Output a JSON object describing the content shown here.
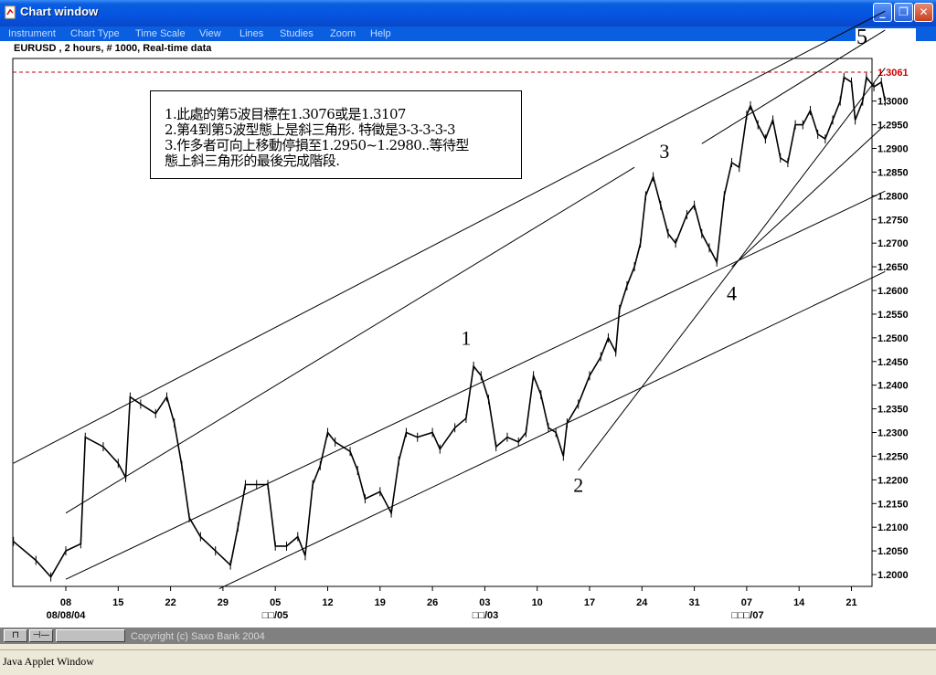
{
  "window": {
    "title": "Chart window",
    "controls": {
      "minimize": "_",
      "restore": "❐",
      "close": "✕"
    }
  },
  "menu": [
    "Instrument",
    "Chart Type",
    "Time Scale",
    "View",
    "Lines",
    "Studies",
    "Zoom",
    "Help"
  ],
  "chart_header": "EURUSD , 2 hours, # 1000, Real-time data",
  "annotation": {
    "lines": [
      "1.此處的第5波目標在1.3076或是1.3107",
      "2.第4到第5波型態上是斜三角形.   特徵是3-3-3-3-3",
      "3.作多者可向上移動停損至1.2950~1.2980..等待型",
      "態上斜三角形的最後完成階段."
    ]
  },
  "status": {
    "copyright": "Copyright (c) Saxo Bank 2004",
    "button1": "⊓",
    "button2": "⊣—"
  },
  "applet_label": "Java Applet Window",
  "colors": {
    "price_line": "#000000",
    "reference_line": "#cc0000",
    "current_price_label": "#cc0000"
  },
  "chart_data": {
    "type": "line",
    "title": "EURUSD , 2 hours, # 1000, Real-time data",
    "ylim": [
      1.1975,
      1.309
    ],
    "y_ticks": [
      "1.2000",
      "1.2050",
      "1.2100",
      "1.2150",
      "1.2200",
      "1.2250",
      "1.2300",
      "1.2350",
      "1.2400",
      "1.2450",
      "1.2500",
      "1.2550",
      "1.2600",
      "1.2650",
      "1.2700",
      "1.2750",
      "1.2800",
      "1.2850",
      "1.2900",
      "1.2950",
      "1.3000"
    ],
    "current_price": "1.3061",
    "x_tick_labels": [
      "08",
      "15",
      "22",
      "29",
      "05",
      "12",
      "19",
      "26",
      "03",
      "10",
      "17",
      "24",
      "31",
      "07",
      "14",
      "21"
    ],
    "x_month_labels": [
      "08/08/04",
      "□□/05",
      "□□/03",
      "□□□/07"
    ],
    "series": [
      {
        "points": [
          {
            "x": 0,
            "y": 1.207
          },
          {
            "x": 3,
            "y": 1.203
          },
          {
            "x": 5,
            "y": 1.1995
          },
          {
            "x": 7,
            "y": 1.205
          },
          {
            "x": 9,
            "y": 1.2065
          },
          {
            "x": 9.6,
            "y": 1.229
          },
          {
            "x": 12,
            "y": 1.227
          },
          {
            "x": 14,
            "y": 1.2235
          },
          {
            "x": 15,
            "y": 1.2205
          },
          {
            "x": 15.6,
            "y": 1.2375
          },
          {
            "x": 17,
            "y": 1.236
          },
          {
            "x": 19,
            "y": 1.234
          },
          {
            "x": 20.5,
            "y": 1.2375
          },
          {
            "x": 21.5,
            "y": 1.232
          },
          {
            "x": 22.5,
            "y": 1.223
          },
          {
            "x": 23.5,
            "y": 1.212
          },
          {
            "x": 25,
            "y": 1.208
          },
          {
            "x": 27,
            "y": 1.205
          },
          {
            "x": 29,
            "y": 1.202
          },
          {
            "x": 30,
            "y": 1.21
          },
          {
            "x": 31,
            "y": 1.219
          },
          {
            "x": 32.5,
            "y": 1.219
          },
          {
            "x": 34,
            "y": 1.219
          },
          {
            "x": 35,
            "y": 1.206
          },
          {
            "x": 36.5,
            "y": 1.206
          },
          {
            "x": 38,
            "y": 1.208
          },
          {
            "x": 39,
            "y": 1.204
          },
          {
            "x": 40,
            "y": 1.219
          },
          {
            "x": 41,
            "y": 1.223
          },
          {
            "x": 42,
            "y": 1.23
          },
          {
            "x": 43,
            "y": 1.228
          },
          {
            "x": 45,
            "y": 1.226
          },
          {
            "x": 46,
            "y": 1.222
          },
          {
            "x": 47,
            "y": 1.216
          },
          {
            "x": 49,
            "y": 1.2175
          },
          {
            "x": 50.5,
            "y": 1.213
          },
          {
            "x": 51.5,
            "y": 1.224
          },
          {
            "x": 52.5,
            "y": 1.23
          },
          {
            "x": 54,
            "y": 1.229
          },
          {
            "x": 56,
            "y": 1.23
          },
          {
            "x": 57,
            "y": 1.2265
          },
          {
            "x": 59,
            "y": 1.231
          },
          {
            "x": 60.5,
            "y": 1.233
          },
          {
            "x": 61.5,
            "y": 1.244
          },
          {
            "x": 62.5,
            "y": 1.242
          },
          {
            "x": 63.5,
            "y": 1.237
          },
          {
            "x": 64.5,
            "y": 1.227
          },
          {
            "x": 66,
            "y": 1.229
          },
          {
            "x": 67.5,
            "y": 1.228
          },
          {
            "x": 68.5,
            "y": 1.23
          },
          {
            "x": 69.5,
            "y": 1.242
          },
          {
            "x": 70.5,
            "y": 1.238
          },
          {
            "x": 71.5,
            "y": 1.231
          },
          {
            "x": 72.5,
            "y": 1.23
          },
          {
            "x": 73.5,
            "y": 1.225
          },
          {
            "x": 74,
            "y": 1.232
          },
          {
            "x": 75.5,
            "y": 1.236
          },
          {
            "x": 77,
            "y": 1.242
          },
          {
            "x": 78.5,
            "y": 1.246
          },
          {
            "x": 79.5,
            "y": 1.25
          },
          {
            "x": 80.5,
            "y": 1.247
          },
          {
            "x": 81,
            "y": 1.256
          },
          {
            "x": 82,
            "y": 1.261
          },
          {
            "x": 83,
            "y": 1.265
          },
          {
            "x": 83.8,
            "y": 1.27
          },
          {
            "x": 84.5,
            "y": 1.28
          },
          {
            "x": 85.5,
            "y": 1.284
          },
          {
            "x": 86.5,
            "y": 1.278
          },
          {
            "x": 87.5,
            "y": 1.272
          },
          {
            "x": 88.5,
            "y": 1.27
          },
          {
            "x": 90,
            "y": 1.276
          },
          {
            "x": 91,
            "y": 1.278
          },
          {
            "x": 92,
            "y": 1.272
          },
          {
            "x": 93,
            "y": 1.269
          },
          {
            "x": 94,
            "y": 1.266
          },
          {
            "x": 95,
            "y": 1.28
          },
          {
            "x": 96,
            "y": 1.287
          },
          {
            "x": 97,
            "y": 1.286
          },
          {
            "x": 98,
            "y": 1.297
          },
          {
            "x": 98.5,
            "y": 1.299
          },
          {
            "x": 99.5,
            "y": 1.295
          },
          {
            "x": 100.5,
            "y": 1.292
          },
          {
            "x": 101.5,
            "y": 1.296
          },
          {
            "x": 102.5,
            "y": 1.288
          },
          {
            "x": 103.5,
            "y": 1.287
          },
          {
            "x": 104.5,
            "y": 1.295
          },
          {
            "x": 105.5,
            "y": 1.295
          },
          {
            "x": 106.5,
            "y": 1.298
          },
          {
            "x": 107.5,
            "y": 1.293
          },
          {
            "x": 108.5,
            "y": 1.292
          },
          {
            "x": 109.5,
            "y": 1.296
          },
          {
            "x": 110.5,
            "y": 1.3
          },
          {
            "x": 111,
            "y": 1.305
          },
          {
            "x": 112,
            "y": 1.304
          },
          {
            "x": 112.5,
            "y": 1.296
          },
          {
            "x": 113.5,
            "y": 1.3
          },
          {
            "x": 114,
            "y": 1.305
          },
          {
            "x": 115,
            "y": 1.303
          },
          {
            "x": 116,
            "y": 1.304
          },
          {
            "x": 116.5,
            "y": 1.3
          }
        ]
      }
    ],
    "trend_lines": [
      {
        "from": {
          "x": 0,
          "y": 1.2235
        },
        "to": {
          "x": 116.5,
          "y": 1.319
        }
      },
      {
        "from": {
          "x": 7,
          "y": 1.213
        },
        "to": {
          "x": 83,
          "y": 1.286
        }
      },
      {
        "from": {
          "x": 92,
          "y": 1.291
        },
        "to": {
          "x": 116.5,
          "y": 1.315
        }
      },
      {
        "from": {
          "x": 7,
          "y": 1.199
        },
        "to": {
          "x": 116.5,
          "y": 1.281
        }
      },
      {
        "from": {
          "x": 27.5,
          "y": 1.197
        },
        "to": {
          "x": 116.5,
          "y": 1.264
        }
      },
      {
        "from": {
          "x": 75.5,
          "y": 1.222
        },
        "to": {
          "x": 116.5,
          "y": 1.307
        }
      },
      {
        "from": {
          "x": 96,
          "y": 1.265
        },
        "to": {
          "x": 116.5,
          "y": 1.295
        }
      }
    ],
    "wave_labels": [
      {
        "label": "1",
        "x": 60.5,
        "y": 1.2485
      },
      {
        "label": "2",
        "x": 75.5,
        "y": 1.2175
      },
      {
        "label": "3",
        "x": 87,
        "y": 1.288
      },
      {
        "label": "4",
        "x": 96,
        "y": 1.258
      },
      {
        "label": "5",
        "x": 116,
        "y": 1.31
      }
    ]
  }
}
